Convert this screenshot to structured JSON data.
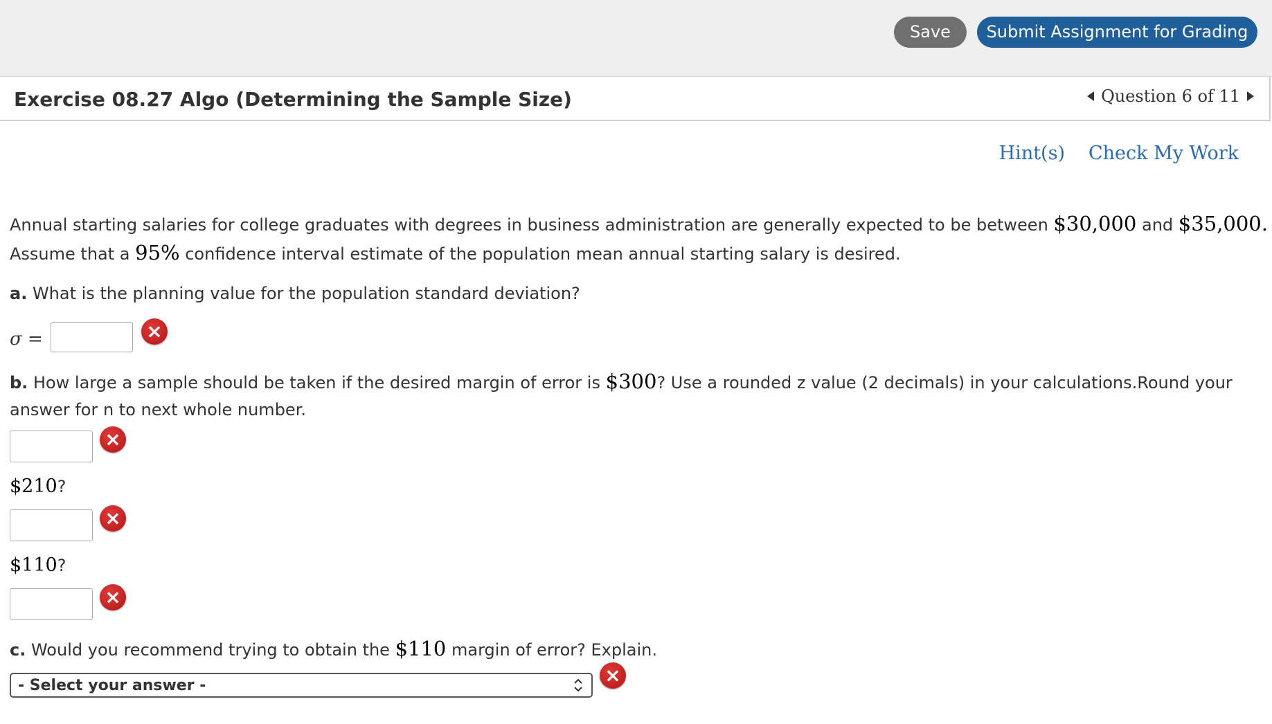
{
  "toolbar": {
    "save_label": "Save",
    "submit_label": "Submit Assignment for Grading"
  },
  "header": {
    "title": "Exercise 08.27 Algo (Determining the Sample Size)",
    "question_nav": "Question 6 of 11"
  },
  "tools": {
    "hints": "Hint(s)",
    "check": "Check My Work"
  },
  "problem": {
    "intro_1": "Annual starting salaries for college graduates with degrees in business administration are generally expected to be between",
    "low_salary": "$30,000",
    "and": "and",
    "high_salary": "$35,000",
    "period": ".",
    "intro_2a": "Assume that a",
    "confidence": "95%",
    "intro_2b": "confidence interval estimate of the population mean annual starting salary is desired.",
    "part_a_letter": "a.",
    "part_a_text": "What is the planning value for the population standard deviation?",
    "sigma_symbol": "σ",
    "sigma_eq": "=",
    "part_b_letter": "b.",
    "part_b_text_1": "How large a sample should be taken if the desired margin of error is",
    "part_b_margin": "$300",
    "part_b_text_2": "? Use a rounded z value (2 decimals) in your calculations.Round your",
    "part_b_text_3": "answer for n to next whole number.",
    "margin_2": "$210",
    "margin_3": "$110",
    "question_mark": "?",
    "part_c_letter": "c.",
    "part_c_text_1": "Would you recommend trying to obtain the",
    "part_c_margin": "$110",
    "part_c_text_2": "margin of error? Explain.",
    "select_value": "- Select your answer -"
  },
  "colors": {
    "submit": "#1f5f9c",
    "save": "#6f6f6f",
    "link": "#2a6bb5",
    "error": "#c41e1e"
  },
  "icons": {
    "incorrect": "x-circle-icon"
  }
}
